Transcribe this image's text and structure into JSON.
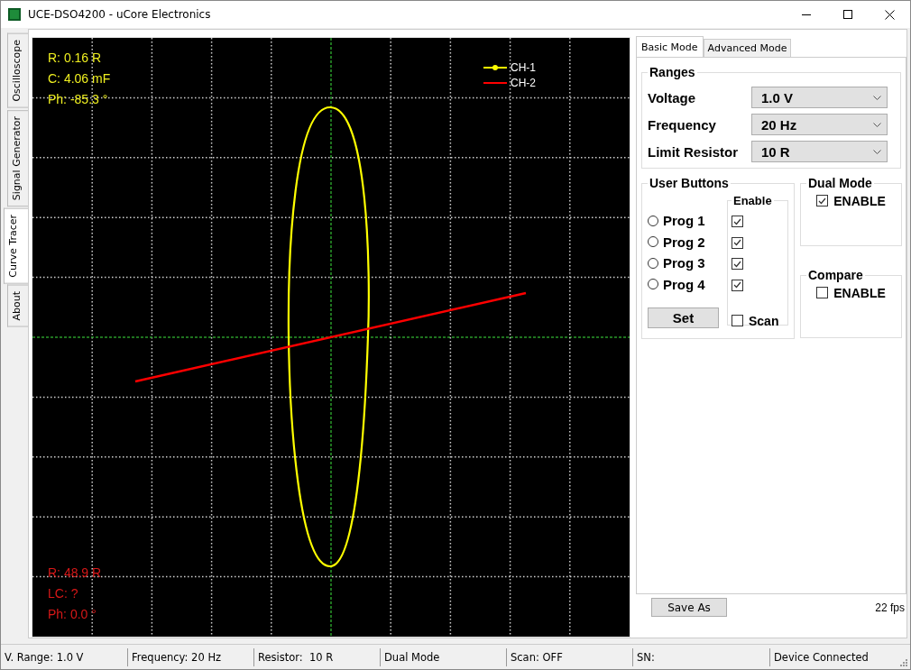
{
  "window": {
    "title": "UCE-DSO4200 - uCore Electronics"
  },
  "side_tabs": [
    {
      "label": "Oscilloscope",
      "selected": false
    },
    {
      "label": "Signal Generator",
      "selected": false
    },
    {
      "label": "Curve Tracer",
      "selected": true
    },
    {
      "label": "About",
      "selected": false
    }
  ],
  "plot": {
    "readouts": [
      {
        "color": "#f0f020",
        "lines": [
          "R: 0.16 R",
          "C: 4.06 mF",
          "Ph: -85.3 °"
        ]
      },
      {
        "color": "#d81818",
        "lines": [
          "R: 48.9 R",
          "LC: ?",
          "Ph: 0.0 °"
        ]
      }
    ],
    "legend": [
      {
        "label": "CH-1",
        "color": "#ffff00"
      },
      {
        "label": "CH-2",
        "color": "#ff0000"
      }
    ]
  },
  "mode_tabs": [
    {
      "label": "Basic Mode",
      "selected": true
    },
    {
      "label": "Advanced Mode",
      "selected": false
    }
  ],
  "ranges": {
    "title": "Ranges",
    "rows": [
      {
        "label": "Voltage",
        "value": "1.0 V"
      },
      {
        "label": "Frequency",
        "value": "20 Hz"
      },
      {
        "label": "Limit Resistor",
        "value": "10 R"
      }
    ]
  },
  "user_buttons": {
    "title": "User Buttons",
    "enable_title": "Enable",
    "progs": [
      {
        "label": "Prog 1",
        "selected": false,
        "checked": true
      },
      {
        "label": "Prog 2",
        "selected": false,
        "checked": true
      },
      {
        "label": "Prog 3",
        "selected": false,
        "checked": true
      },
      {
        "label": "Prog 4",
        "selected": false,
        "checked": true
      }
    ],
    "set_button": "Set",
    "scan": {
      "label": "Scan",
      "checked": false
    }
  },
  "dual_mode": {
    "title": "Dual Mode",
    "label": "ENABLE",
    "checked": true
  },
  "compare": {
    "title": "Compare",
    "label": "ENABLE",
    "checked": false
  },
  "save_button": "Save As",
  "fps": "22 fps",
  "status_bar": [
    "V. Range: 1.0 V",
    "Frequency: 20 Hz",
    "Resistor:  10 R",
    "Dual Mode",
    "Scan: OFF",
    "SN:",
    "Device Connected"
  ]
}
